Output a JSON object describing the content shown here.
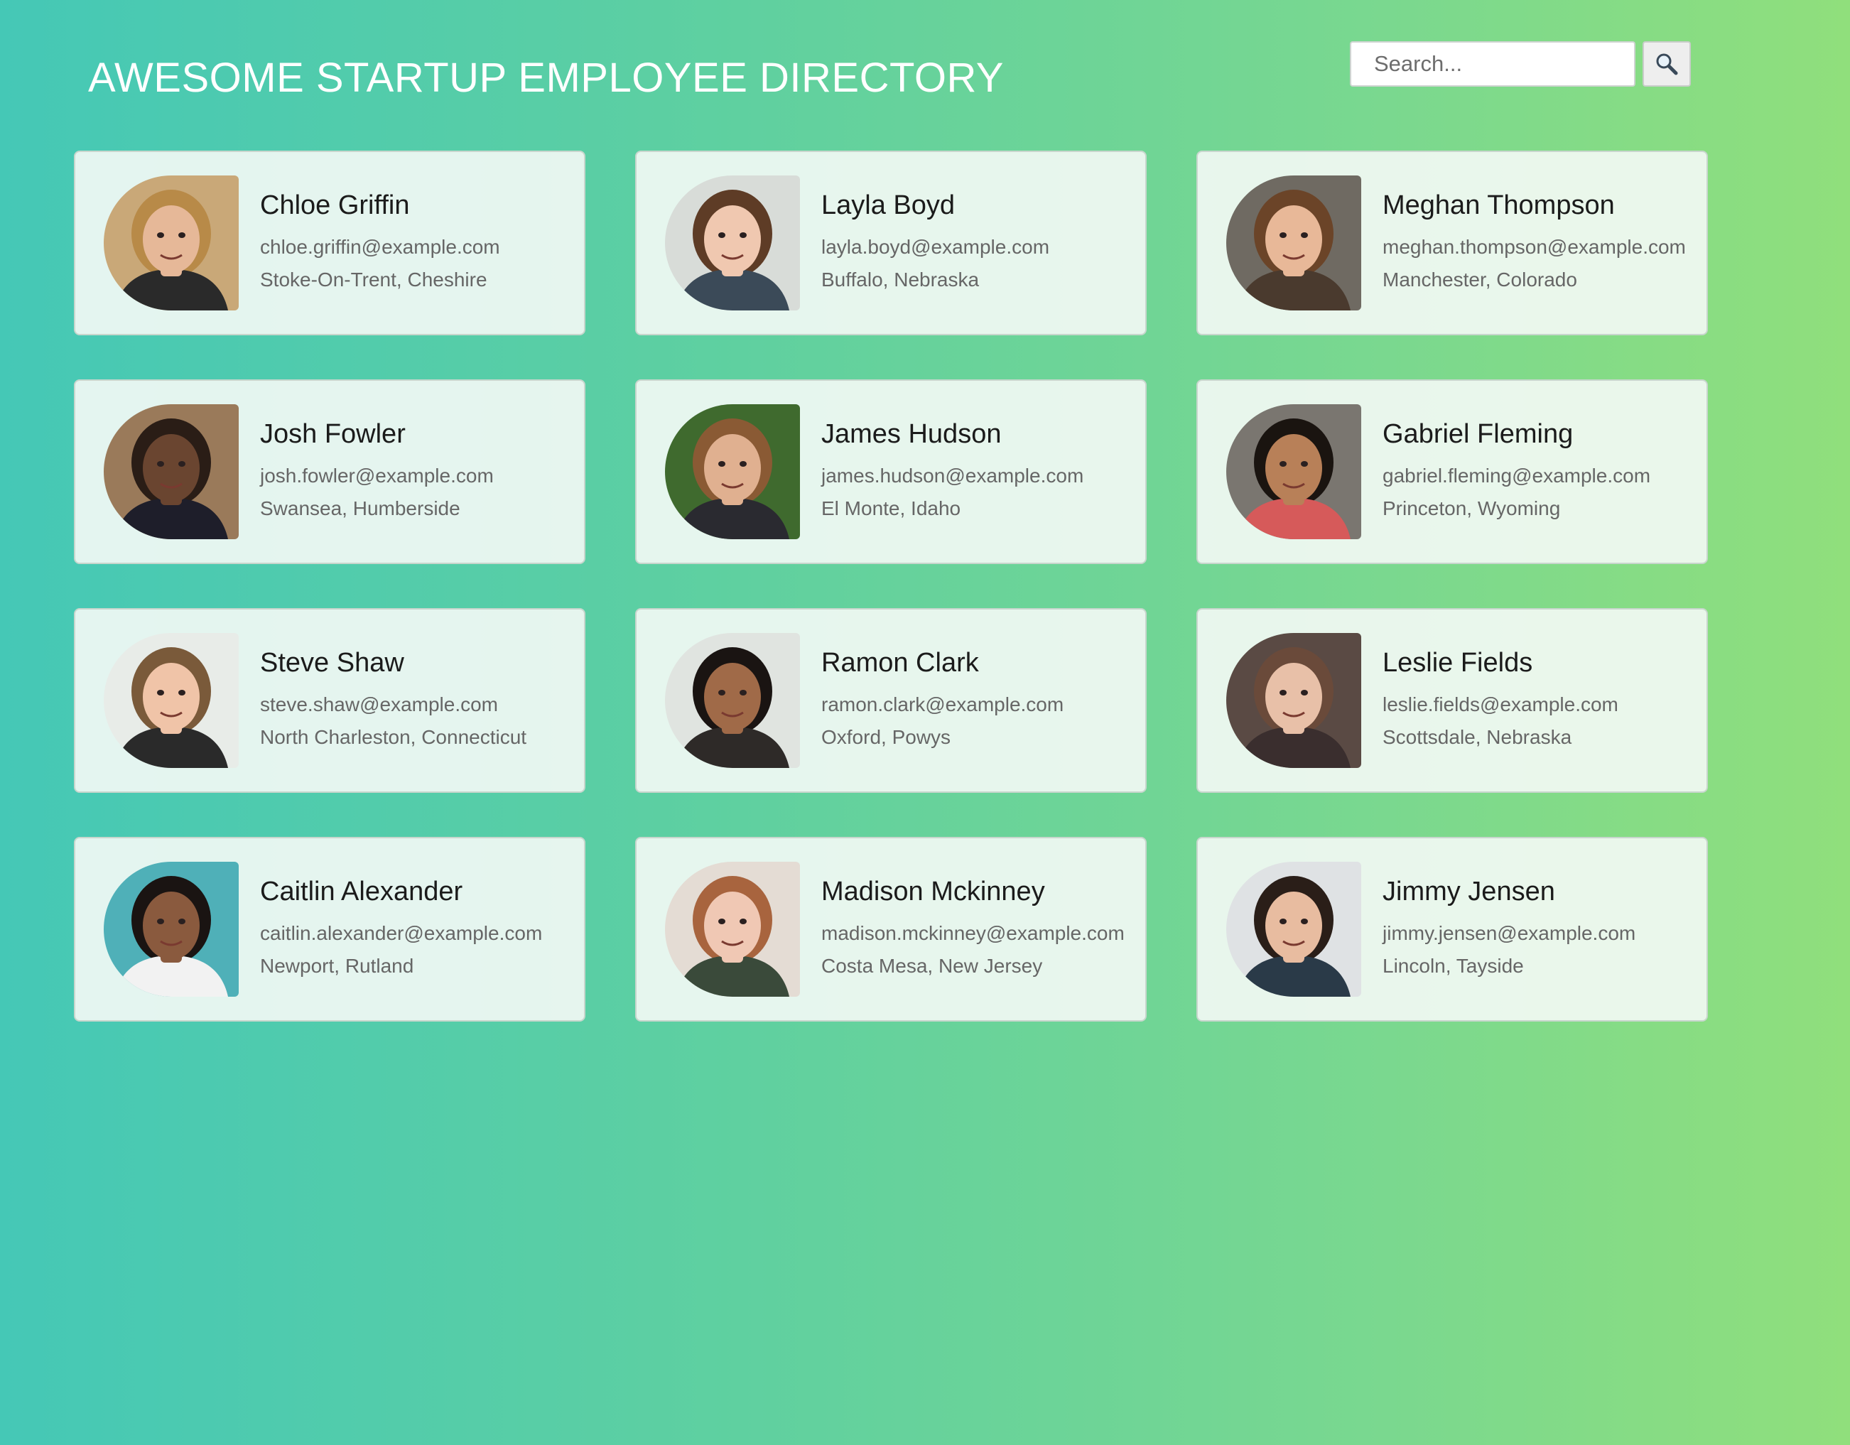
{
  "header": {
    "title": "AWESOME STARTUP EMPLOYEE DIRECTORY"
  },
  "search": {
    "placeholder": "Search...",
    "button_icon": "magnifier-icon"
  },
  "employees": [
    {
      "name": "Chloe Griffin",
      "email": "chloe.griffin@example.com",
      "location": "Stoke-On-Trent, Cheshire",
      "bg": "#c9a878",
      "skin": "#e6b898",
      "hair": "#b88a48",
      "shirt": "#2a2a2a"
    },
    {
      "name": "Layla Boyd",
      "email": "layla.boyd@example.com",
      "location": "Buffalo, Nebraska",
      "bg": "#d8dcd8",
      "skin": "#f0c8b0",
      "hair": "#5e3c26",
      "shirt": "#3b4a58"
    },
    {
      "name": "Meghan Thompson",
      "email": "meghan.thompson@example.com",
      "location": "Manchester, Colorado",
      "bg": "#6f6a62",
      "skin": "#e8b898",
      "hair": "#6b4428",
      "shirt": "#4a3a2e"
    },
    {
      "name": "Josh Fowler",
      "email": "josh.fowler@example.com",
      "location": "Swansea, Humberside",
      "bg": "#9a7a5a",
      "skin": "#6a4530",
      "hair": "#2a1d16",
      "shirt": "#1e1e2a"
    },
    {
      "name": "James Hudson",
      "email": "james.hudson@example.com",
      "location": "El Monte, Idaho",
      "bg": "#3f6a2e",
      "skin": "#e0b090",
      "hair": "#8a5a34",
      "shirt": "#2a2a30"
    },
    {
      "name": "Gabriel Fleming",
      "email": "gabriel.fleming@example.com",
      "location": "Princeton, Wyoming",
      "bg": "#7a7670",
      "skin": "#b88058",
      "hair": "#1a1410",
      "shirt": "#d65a5a"
    },
    {
      "name": "Steve Shaw",
      "email": "steve.shaw@example.com",
      "location": "North Charleston, Connecticut",
      "bg": "#e8ece8",
      "skin": "#f0c4a8",
      "hair": "#7a5a3a",
      "shirt": "#2a2a2a"
    },
    {
      "name": "Ramon Clark",
      "email": "ramon.clark@example.com",
      "location": "Oxford, Powys",
      "bg": "#e0e4e0",
      "skin": "#a06a48",
      "hair": "#1a1412",
      "shirt": "#2e2a28"
    },
    {
      "name": "Leslie Fields",
      "email": "leslie.fields@example.com",
      "location": "Scottsdale, Nebraska",
      "bg": "#5a4a44",
      "skin": "#e8c0a8",
      "hair": "#6a4a3a",
      "shirt": "#3a2e2e"
    },
    {
      "name": "Caitlin Alexander",
      "email": "caitlin.alexander@example.com",
      "location": "Newport, Rutland",
      "bg": "#4fb0b8",
      "skin": "#8a5a3e",
      "hair": "#1a1412",
      "shirt": "#f2f2f2"
    },
    {
      "name": "Madison Mckinney",
      "email": "madison.mckinney@example.com",
      "location": "Costa Mesa, New Jersey",
      "bg": "#e4dcd4",
      "skin": "#f0c8b4",
      "hair": "#a8643e",
      "shirt": "#3a4a3a"
    },
    {
      "name": "Jimmy Jensen",
      "email": "jimmy.jensen@example.com",
      "location": "Lincoln, Tayside",
      "bg": "#dfe2e4",
      "skin": "#e8bca0",
      "hair": "#2a1e18",
      "shirt": "#2a3a48"
    }
  ]
}
